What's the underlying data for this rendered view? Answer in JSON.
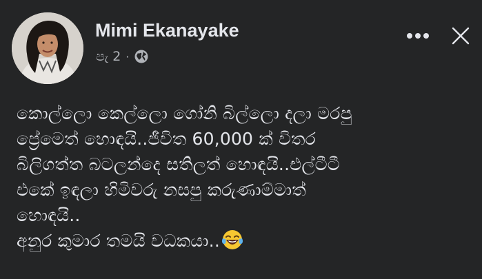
{
  "post": {
    "author_name": "Mimi Ekanayake",
    "timestamp": "පැ 2",
    "separator": "·",
    "privacy_icon": "globe-icon",
    "more_icon": "more-options-icon",
    "close_icon": "close-icon",
    "text_lines": [
      "කොල්ලො කෙල්ලො ගෝනි බිල්ලො දලා මරපු",
      "ප්‍රේමෙත් හොඳයි..ජීවිත 60,000 ක් විතර",
      "බිලිගත්ත බටලන්දෙ සතිලත් හොඳයි..එල්ටීටී",
      "එකේ ඉඳලා හිමිවරු නසපු කරුණාම්මාත්",
      "හොඳයි..",
      "අනුර කුමාර තමයි වධකයා.."
    ],
    "trailing_emoji": "laughing-tears-emoji-icon"
  },
  "colors": {
    "background": "#242526",
    "primary_text": "#e4e6eb",
    "secondary_text": "#b0b3b8"
  }
}
